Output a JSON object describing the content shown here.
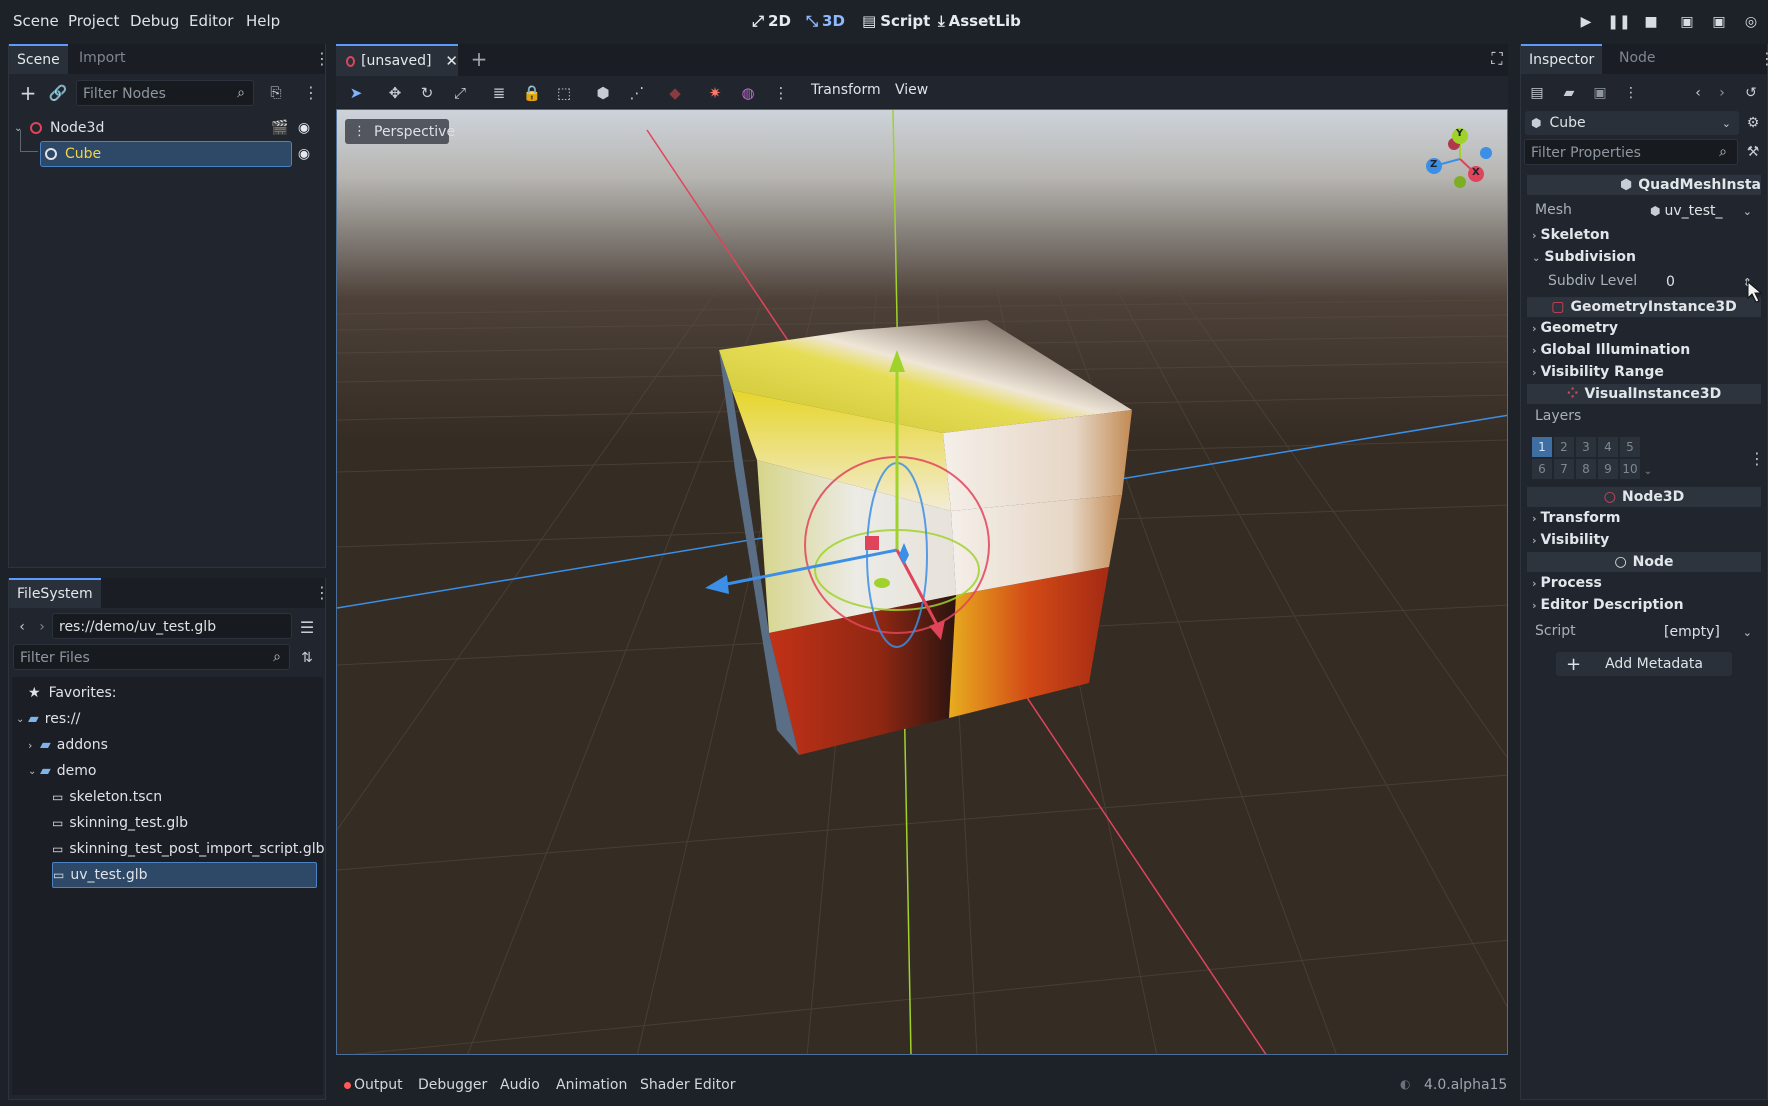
{
  "menu": [
    "Scene",
    "Project",
    "Debug",
    "Editor",
    "Help"
  ],
  "workspaces": [
    {
      "label": "2D",
      "icon": "2d-icon"
    },
    {
      "label": "3D",
      "icon": "3d-icon"
    },
    {
      "label": "Script",
      "icon": "script-icon"
    },
    {
      "label": "AssetLib",
      "icon": "assetlib-icon"
    }
  ],
  "scene_dock": {
    "tabs": [
      "Scene",
      "Import"
    ],
    "filter_placeholder": "Filter Nodes",
    "nodes": [
      {
        "label": "Node3d"
      },
      {
        "label": "Cube"
      }
    ]
  },
  "filesystem": {
    "tab": "FileSystem",
    "path": "res://demo/uv_test.glb",
    "filter_placeholder": "Filter Files",
    "items": [
      {
        "label": "Favorites:"
      },
      {
        "label": "res://"
      },
      {
        "label": "addons"
      },
      {
        "label": "demo"
      },
      {
        "label": "skeleton.tscn"
      },
      {
        "label": "skinning_test.glb"
      },
      {
        "label": "skinning_test_post_import_script.glb"
      },
      {
        "label": "uv_test.glb"
      }
    ]
  },
  "editor": {
    "tab_label": "[unsaved]",
    "toolbar_menus": [
      "Transform",
      "View"
    ],
    "viewport_label": "Perspective",
    "gizmo_axes": [
      "Y",
      "Z",
      "X"
    ]
  },
  "bottom_tabs": [
    "Output",
    "Debugger",
    "Audio",
    "Animation",
    "Shader Editor"
  ],
  "version": "4.0.alpha15",
  "inspector": {
    "tabs": [
      "Inspector",
      "Node"
    ],
    "object_name": "Cube",
    "filter_placeholder": "Filter Properties",
    "sections": {
      "quadmesh": "QuadMeshInsta",
      "geometry": "GeometryInstance3D",
      "visual": "VisualInstance3D",
      "node3d": "Node3D",
      "node": "Node"
    },
    "mesh_label": "Mesh",
    "mesh_value": "uv_test_",
    "groups": {
      "skeleton": "Skeleton",
      "subdivision": "Subdivision",
      "geometry": "Geometry",
      "gi": "Global Illumination",
      "visrange": "Visibility Range",
      "transform": "Transform",
      "visibility": "Visibility",
      "process": "Process",
      "editor_desc": "Editor Description"
    },
    "subdiv_label": "Subdiv Level",
    "subdiv_value": "0",
    "layers_label": "Layers",
    "layers_row1": [
      "1",
      "2",
      "3",
      "4",
      "5"
    ],
    "layers_row2": [
      "6",
      "7",
      "8",
      "9",
      "10"
    ],
    "script_label": "Script",
    "script_value": "[empty]",
    "add_metadata": "Add Metadata"
  },
  "colors": {
    "accent": "#5b9bff",
    "selected_node": "#f2d44b",
    "x_axis": "#e0445a",
    "y_axis": "#a0d22c",
    "z_axis": "#3b8fe6"
  }
}
